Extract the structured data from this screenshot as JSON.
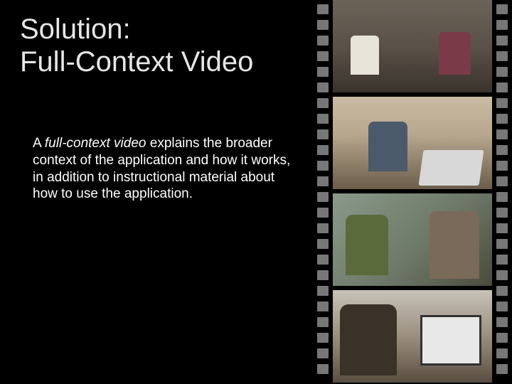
{
  "title_line1": "Solution:",
  "title_line2": "Full-Context Video",
  "body": {
    "italic_lead": "full-context video",
    "prefix": "A ",
    "rest": " explains the broader context of the application and how it works, in addition to instructional material about how to use the application."
  },
  "filmstrip": {
    "frames": [
      {
        "desc": "two-people-seated-couch"
      },
      {
        "desc": "man-at-laptop-woman-behind"
      },
      {
        "desc": "two-women-closeup"
      },
      {
        "desc": "person-looking-at-screen"
      }
    ]
  }
}
